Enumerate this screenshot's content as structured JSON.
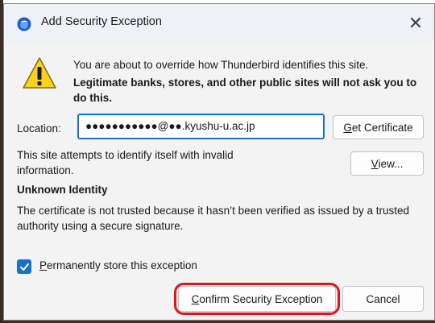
{
  "window": {
    "title": "Add Security Exception",
    "close_glyph": "✕"
  },
  "warning": {
    "icon": "warning-icon",
    "intro": "You are about to override how Thunderbird identifies this site.",
    "bold": "Legitimate banks, stores, and other public sites will not ask you to do this."
  },
  "location": {
    "label": "Location:",
    "value": "●●●●●●●●●●●@●●.kyushu-u.ac.jp",
    "get_certificate_prefix": "G",
    "get_certificate_rest": "et Certificate"
  },
  "site": {
    "message": "This site attempts to identify itself with invalid information.",
    "view_prefix": "V",
    "view_rest": "iew..."
  },
  "unknown_identity": {
    "heading": "Unknown Identity",
    "text": "The certificate is not trusted because it hasn’t been verified as issued by a trusted authority using a secure signature."
  },
  "permanent": {
    "checked": true,
    "label_prefix": "P",
    "label_rest": "ermanently store this exception"
  },
  "buttons": {
    "confirm_prefix": "C",
    "confirm_rest": "onfirm Security Exception",
    "cancel": "Cancel"
  },
  "colors": {
    "accent": "#1a6fc9",
    "highlight_ring": "#e0161b",
    "warning_yellow": "#f7d21e"
  }
}
